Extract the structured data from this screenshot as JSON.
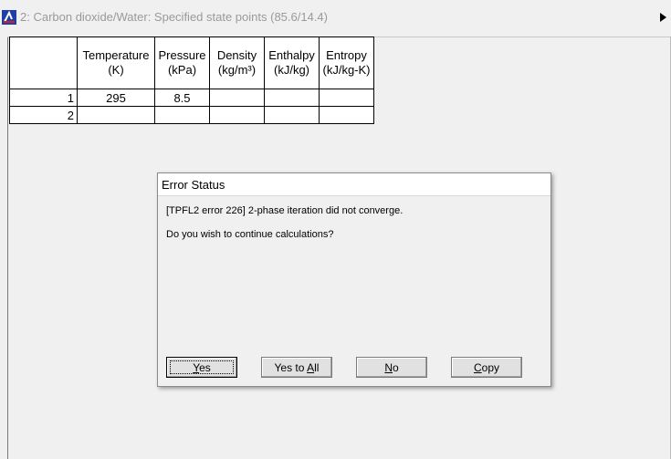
{
  "window": {
    "title": "2: Carbon dioxide/Water: Specified state points (85.6/14.4)"
  },
  "grid": {
    "columns": [
      {
        "line1": "Temperature",
        "line2": "(K)"
      },
      {
        "line1": "Pressure",
        "line2": "(kPa)"
      },
      {
        "line1": "Density",
        "line2": "(kg/m³)"
      },
      {
        "line1": "Enthalpy",
        "line2": "(kJ/kg)"
      },
      {
        "line1": "Entropy",
        "line2": "(kJ/kg-K)"
      }
    ],
    "rows": [
      {
        "num": "1",
        "cells": [
          "295",
          "8.5",
          "",
          "",
          ""
        ]
      },
      {
        "num": "2",
        "cells": [
          "",
          "",
          "",
          "",
          ""
        ]
      }
    ]
  },
  "dialog": {
    "title": "Error Status",
    "message": "[TPFL2 error 226] 2-phase iteration did not converge.",
    "question": "Do you wish to continue calculations?",
    "buttons": {
      "yes": {
        "pre": "",
        "accel": "Y",
        "post": "es"
      },
      "yes_to_all": {
        "pre": "Yes to ",
        "accel": "A",
        "post": "ll"
      },
      "no": {
        "pre": "",
        "accel": "N",
        "post": "o"
      },
      "copy": {
        "pre": "",
        "accel": "C",
        "post": "opy"
      }
    }
  },
  "colors": {
    "background": "#f0f0f0",
    "title_text": "#9a9a9a",
    "app_icon_blue": "#1f3fa8"
  }
}
